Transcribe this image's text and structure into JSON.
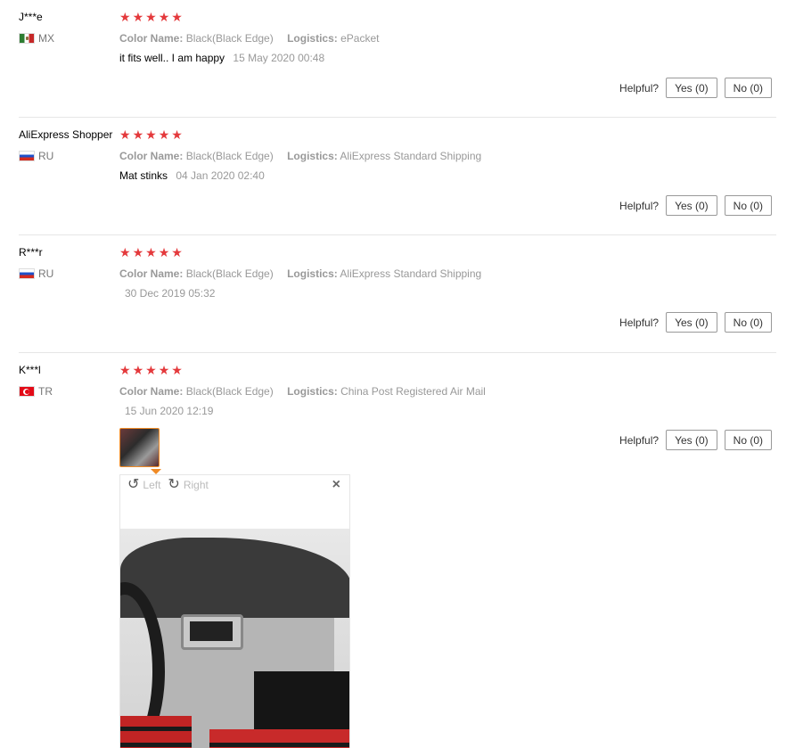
{
  "reviews": [
    {
      "user": "J***e",
      "country": "MX",
      "flag": "flag-mx",
      "stars": 5,
      "color_label": "Color Name:",
      "color_value": "Black(Black Edge)",
      "logistics_label": "Logistics:",
      "logistics_value": "ePacket",
      "text": "it fits well.. I am happy",
      "date": "15 May 2020 00:48",
      "helpful_label": "Helpful?",
      "yes_label": "Yes (0)",
      "no_label": "No (0)"
    },
    {
      "user": "AliExpress Shopper",
      "country": "RU",
      "flag": "flag-ru",
      "stars": 5,
      "color_label": "Color Name:",
      "color_value": "Black(Black Edge)",
      "logistics_label": "Logistics:",
      "logistics_value": "AliExpress Standard Shipping",
      "text": "Mat stinks",
      "date": "04 Jan 2020 02:40",
      "helpful_label": "Helpful?",
      "yes_label": "Yes (0)",
      "no_label": "No (0)"
    },
    {
      "user": "R***r",
      "country": "RU",
      "flag": "flag-ru",
      "stars": 5,
      "color_label": "Color Name:",
      "color_value": "Black(Black Edge)",
      "logistics_label": "Logistics:",
      "logistics_value": "AliExpress Standard Shipping",
      "text": "",
      "date": "30 Dec 2019 05:32",
      "helpful_label": "Helpful?",
      "yes_label": "Yes (0)",
      "no_label": "No (0)"
    },
    {
      "user": "K***l",
      "country": "TR",
      "flag": "flag-tr",
      "stars": 5,
      "color_label": "Color Name:",
      "color_value": "Black(Black Edge)",
      "logistics_label": "Logistics:",
      "logistics_value": "China Post Registered Air Mail",
      "text": "",
      "date": "15 Jun 2020 12:19",
      "helpful_label": "Helpful?",
      "yes_label": "Yes (0)",
      "no_label": "No (0)"
    }
  ],
  "viewer": {
    "rotate_left_label": "Left",
    "rotate_right_label": "Right",
    "close_glyph": "×"
  },
  "colors": {
    "star": "#e4393c",
    "thumb_border": "#f08a24",
    "divider": "#e6e6e6"
  }
}
